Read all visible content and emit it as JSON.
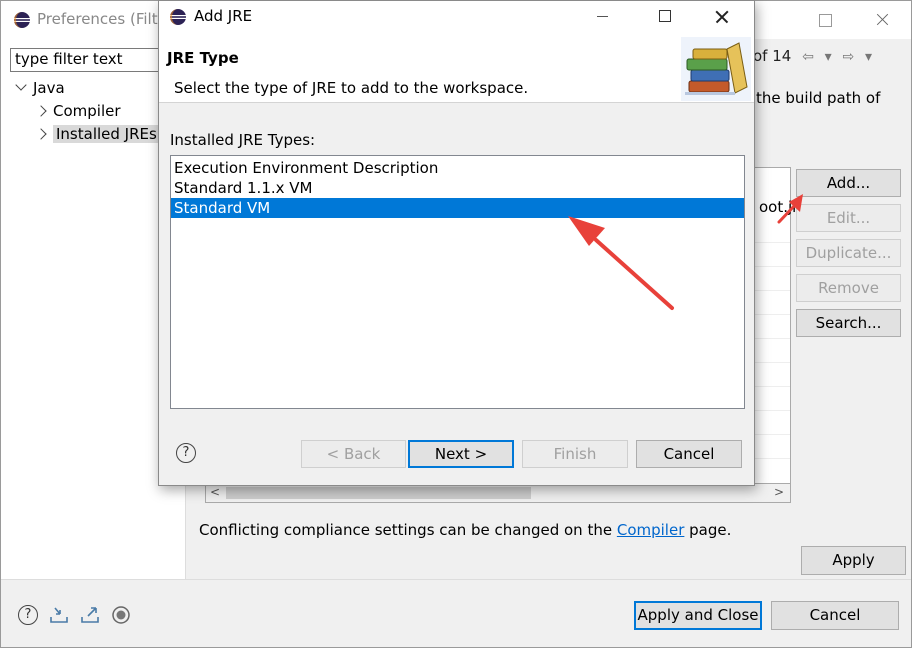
{
  "preferences": {
    "title": "Preferences (Filte",
    "filter_placeholder": "type filter text",
    "tree": {
      "java": "Java",
      "compiler": "Compiler",
      "installed_jres": "Installed JREs"
    },
    "nav_text": "of 14",
    "desc_fragment": "the build path of",
    "boot_fragment": "oot.jr",
    "side_buttons": {
      "add": "Add...",
      "edit": "Edit...",
      "duplicate": "Duplicate...",
      "remove": "Remove",
      "search": "Search..."
    },
    "conflict_text_pre": "Conflicting compliance settings can be changed on the ",
    "conflict_link": "Compiler",
    "conflict_text_post": " page.",
    "apply": "Apply",
    "apply_and_close": "Apply and Close",
    "cancel": "Cancel"
  },
  "dialog": {
    "title": "Add JRE",
    "header_title": "JRE Type",
    "header_desc": "Select the type of JRE to add to the workspace.",
    "list_label": "Installed JRE Types:",
    "types": [
      "Execution Environment Description",
      "Standard 1.1.x VM",
      "Standard VM"
    ],
    "selected_type": "Standard VM",
    "buttons": {
      "back": "< Back",
      "next": "Next >",
      "finish": "Finish",
      "cancel": "Cancel"
    },
    "help": "?"
  },
  "colors": {
    "selection": "#0078d7",
    "annotation_arrow": "#e8413a",
    "link": "#0066cc"
  },
  "icons": {
    "app": "eclipse-icon",
    "help": "help-icon",
    "header": "books-icon"
  }
}
